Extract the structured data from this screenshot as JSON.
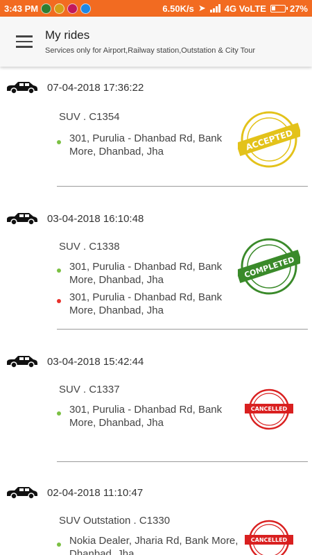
{
  "status_bar": {
    "time": "3:43 PM",
    "speed": "6.50K/s",
    "network": "4G VoLTE",
    "battery": "27%",
    "colors": {
      "background": "#f26b21"
    }
  },
  "app_bar": {
    "title": "My rides",
    "subtitle": "Services only for Airport,Railway station,Outstation & City Tour"
  },
  "rides": [
    {
      "datetime": "07-04-2018 17:36:22",
      "vehicle": "SUV . C1354",
      "locations": [
        "301, Purulia - Dhanbad Rd, Bank More, Dhanbad, Jha"
      ],
      "status": "ACCEPTED",
      "status_color": "#e3c21a"
    },
    {
      "datetime": "03-04-2018 16:10:48",
      "vehicle": "SUV . C1338",
      "locations": [
        "301, Purulia - Dhanbad Rd, Bank More, Dhanbad, Jha",
        "301, Purulia - Dhanbad Rd, Bank More, Dhanbad, Jha"
      ],
      "status": "COMPLETED",
      "status_color": "#3a8a2a"
    },
    {
      "datetime": "03-04-2018 15:42:44",
      "vehicle": "SUV . C1337",
      "locations": [
        "301, Purulia - Dhanbad Rd, Bank More, Dhanbad, Jha"
      ],
      "status": "CANCELLED",
      "status_color": "#d92020"
    },
    {
      "datetime": "02-04-2018 11:10:47",
      "vehicle": "SUV Outstation . C1330",
      "locations": [
        "Nokia Dealer, Jharia Rd, Bank More, Dhanbad, Jha"
      ],
      "status": "CANCELLED",
      "status_color": "#d92020"
    }
  ]
}
